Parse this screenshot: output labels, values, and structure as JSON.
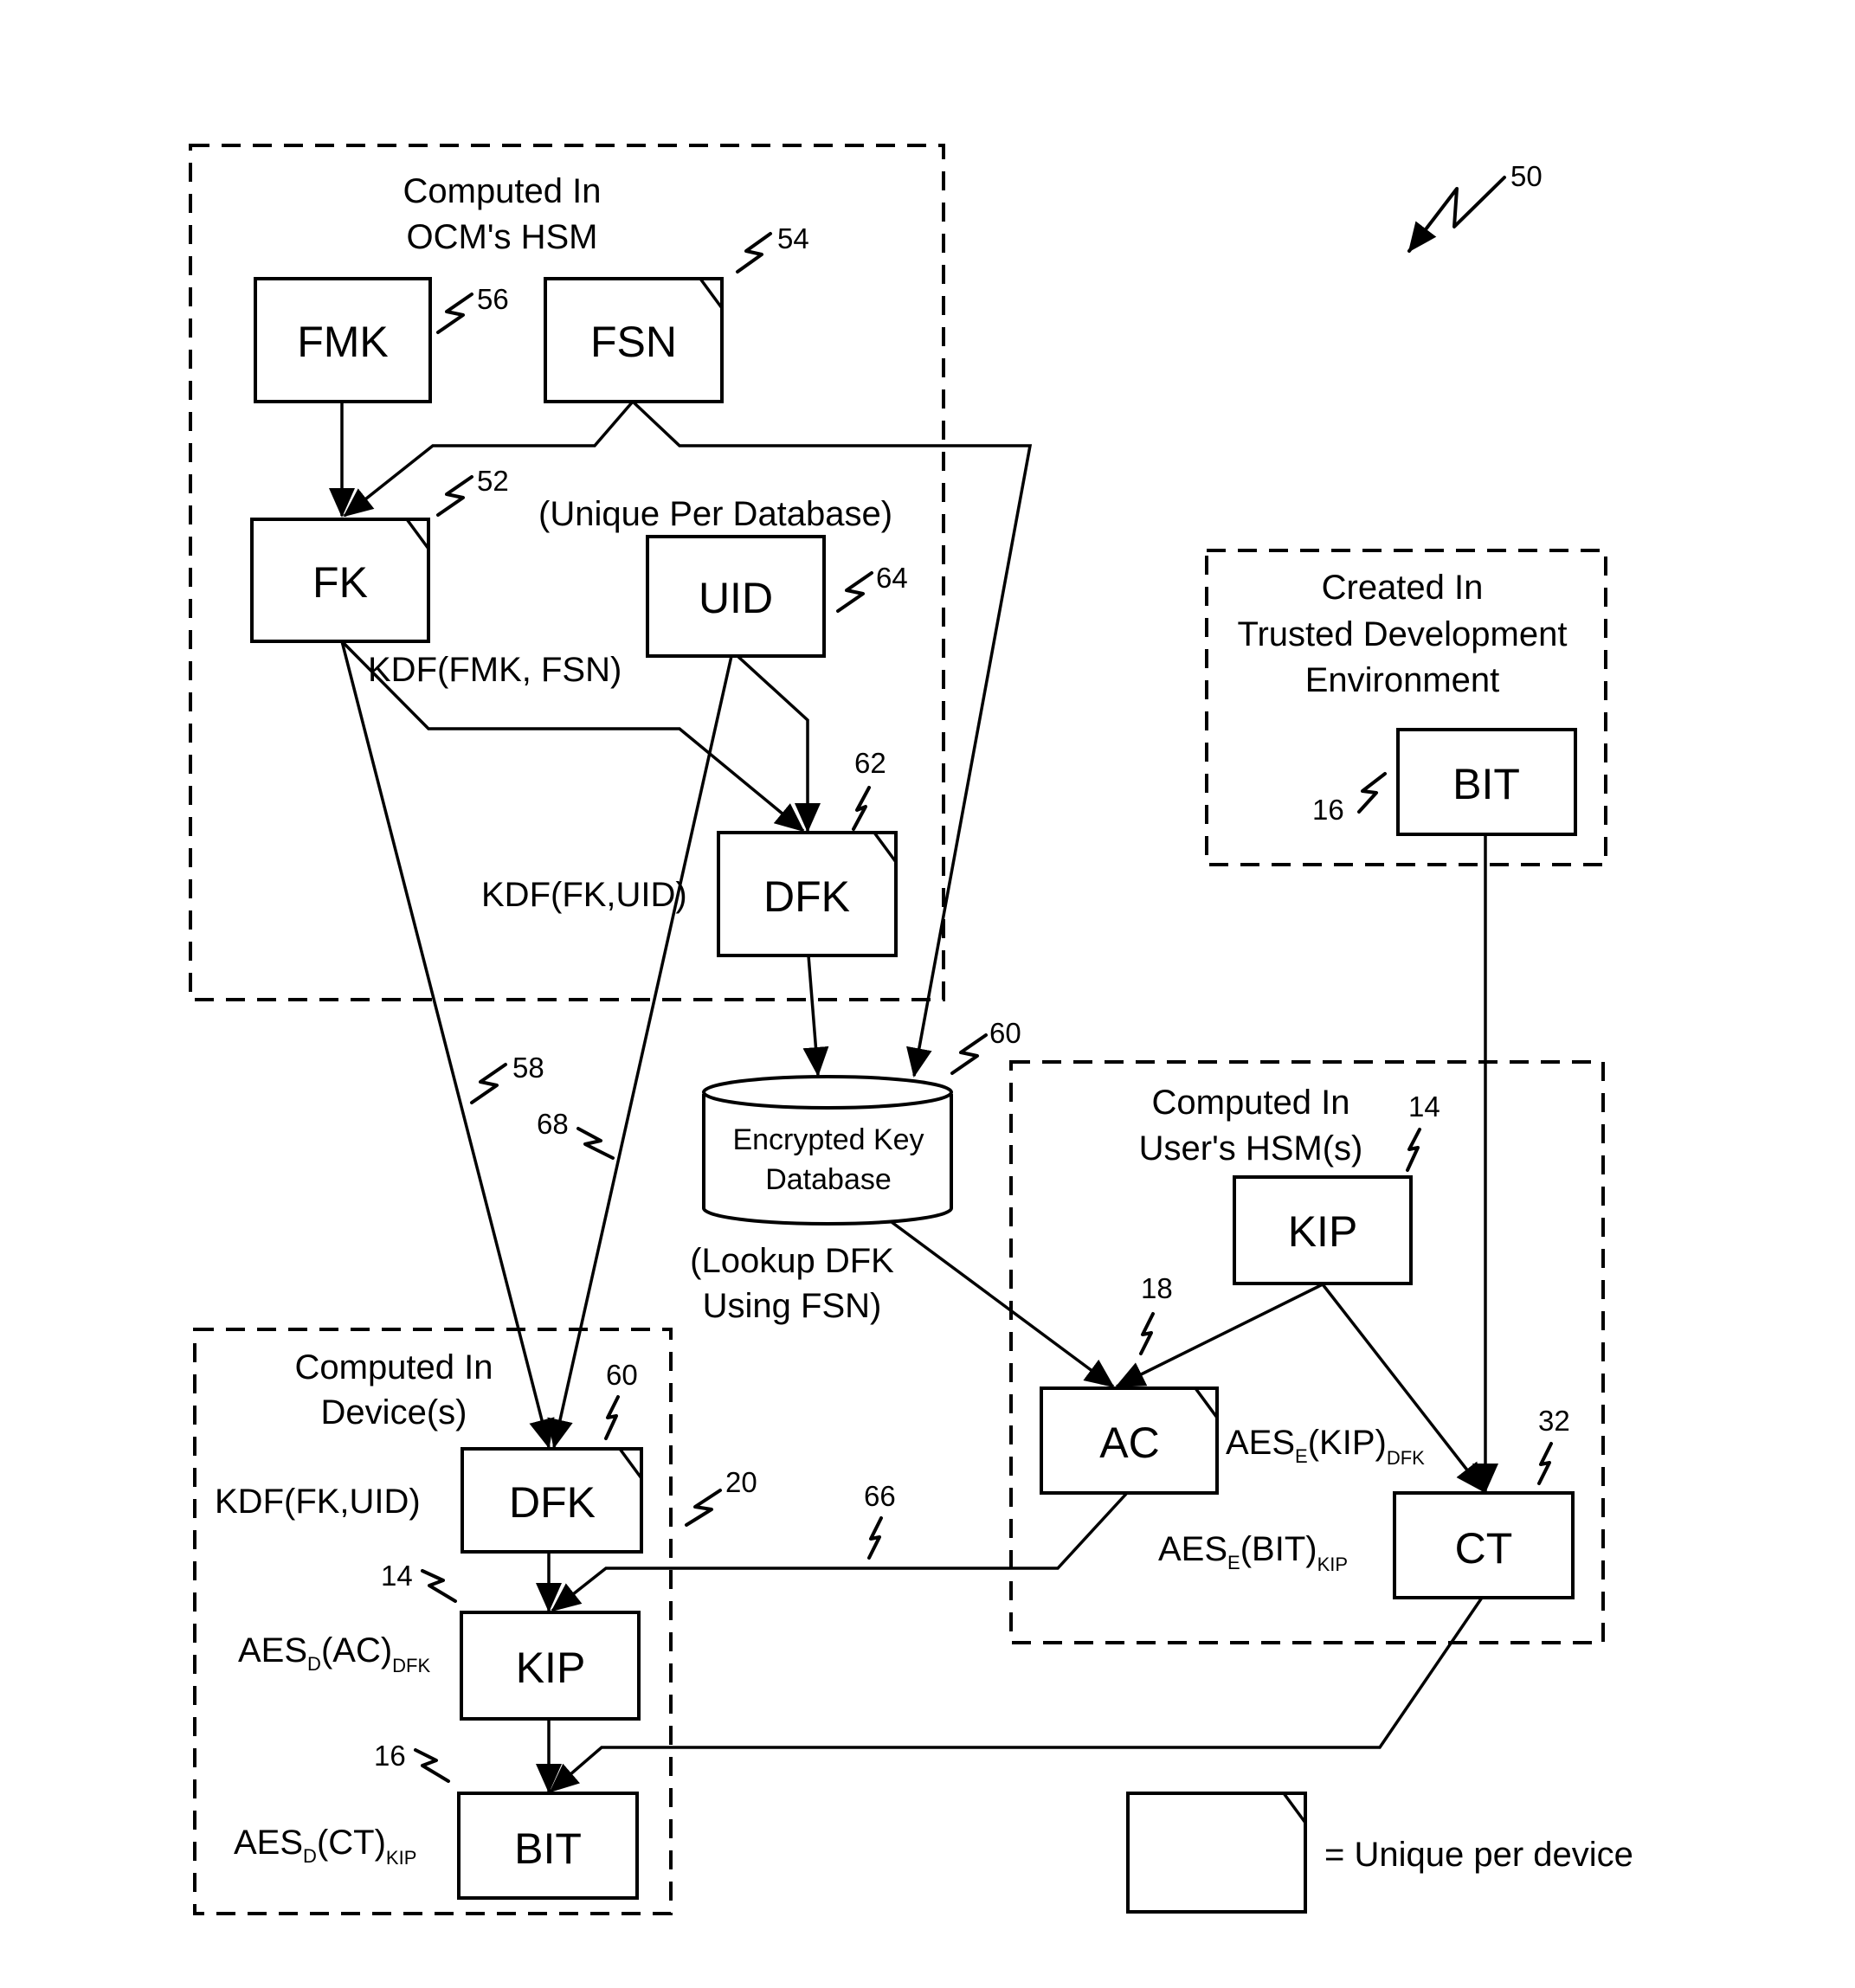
{
  "figure_ref": "50",
  "regions": {
    "ocm": {
      "title_line1": "Computed In",
      "title_line2": "OCM's HSM"
    },
    "trusted": {
      "title_line1": "Created In",
      "title_line2": "Trusted Development",
      "title_line3": "Environment"
    },
    "user_hsm": {
      "title_line1": "Computed In",
      "title_line2": "User's HSM(s)"
    },
    "device": {
      "title_line1": "Computed In",
      "title_line2": "Device(s)",
      "ref": "20"
    }
  },
  "nodes": {
    "fmk": {
      "label": "FMK",
      "ref": "56",
      "unique_per_device": false
    },
    "fsn": {
      "label": "FSN",
      "ref": "54",
      "unique_per_device": true
    },
    "fk": {
      "label": "FK",
      "ref": "52",
      "unique_per_device": true
    },
    "uid": {
      "label": "UID",
      "ref": "64",
      "unique_per_device": false,
      "note": "(Unique Per Database)"
    },
    "dfk_ocm": {
      "label": "DFK",
      "ref": "62",
      "unique_per_device": true
    },
    "bit_trusted": {
      "label": "BIT",
      "ref": "16",
      "unique_per_device": false
    },
    "database": {
      "line1": "Encrypted Key",
      "line2": "Database",
      "ref": "60",
      "note_line1": "(Lookup DFK",
      "note_line2": "Using FSN)"
    },
    "kip_user": {
      "label": "KIP",
      "ref": "14",
      "unique_per_device": false
    },
    "ac": {
      "label": "AC",
      "ref": "18",
      "unique_per_device": true
    },
    "ct": {
      "label": "CT",
      "ref": "32",
      "unique_per_device": false
    },
    "dfk_device": {
      "label": "DFK",
      "ref": "60",
      "unique_per_device": true
    },
    "kip_device": {
      "label": "KIP",
      "ref": "14",
      "unique_per_device": false
    },
    "bit_device": {
      "label": "BIT",
      "ref": "16",
      "unique_per_device": false
    }
  },
  "formulas": {
    "fk_kdf": "KDF(FMK, FSN)",
    "dfk_kdf_ocm": "KDF(FK,UID)",
    "ac_enc": {
      "main": "AES",
      "sub1": "E",
      "arg": "(KIP)",
      "sub2": "DFK"
    },
    "ct_enc": {
      "main": "AES",
      "sub1": "E",
      "arg": "(BIT)",
      "sub2": "KIP"
    },
    "dfk_kdf_device": "KDF(FK,UID)",
    "kip_dec": {
      "main": "AES",
      "sub1": "D",
      "arg": "(AC)",
      "sub2": "DFK"
    },
    "bit_dec": {
      "main": "AES",
      "sub1": "D",
      "arg": "(CT)",
      "sub2": "KIP"
    }
  },
  "connector_refs": {
    "fk_to_device": "58",
    "uid_to_device": "68",
    "ac_to_device": "66"
  },
  "legend": {
    "text": "= Unique per device"
  }
}
